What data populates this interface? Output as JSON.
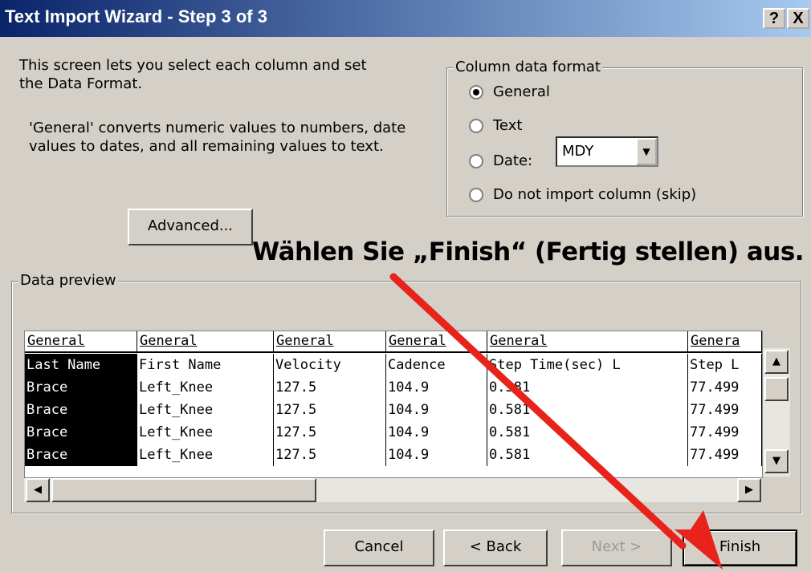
{
  "window": {
    "title": "Text Import Wizard - Step 3 of 3",
    "help_label": "?",
    "close_label": "X"
  },
  "description": {
    "line1": "This screen lets you select each column and set",
    "line2": "the Data Format.",
    "line3": "'General' converts numeric values to numbers, date",
    "line4": "values to dates, and all remaining values to text."
  },
  "column_format": {
    "legend": "Column data format",
    "options": [
      {
        "label": "General",
        "selected": true
      },
      {
        "label": "Text",
        "selected": false
      },
      {
        "label": "Date:",
        "selected": false
      },
      {
        "label": "Do not import column (skip)",
        "selected": false
      }
    ],
    "date_value": "MDY"
  },
  "advanced_label": "Advanced...",
  "annotation": "Wählen Sie „Finish“ (Fertig stellen) aus.",
  "preview": {
    "legend": "Data preview",
    "headers": [
      "General",
      "General",
      "General",
      "General",
      "General",
      "Genera"
    ],
    "rows": [
      [
        "Last Name",
        "First Name",
        "Velocity",
        "Cadence",
        "Step Time(sec) L",
        "Step L"
      ],
      [
        "Brace",
        "Left_Knee",
        "127.5",
        "104.9",
        "0.581",
        "77.499"
      ],
      [
        "Brace",
        "Left_Knee",
        "127.5",
        "104.9",
        "0.581",
        "77.499"
      ],
      [
        "Brace",
        "Left_Knee",
        "127.5",
        "104.9",
        "0.581",
        "77.499"
      ],
      [
        "Brace",
        "Left_Knee",
        "127.5",
        "104.9",
        "0.581",
        "77.499"
      ]
    ]
  },
  "buttons": {
    "cancel": "Cancel",
    "back": "< Back",
    "next": "Next >",
    "finish": "Finish"
  },
  "colors": {
    "titlebar": "#0a246a",
    "face": "#d4d0c8",
    "arrow": "#e8231b"
  }
}
